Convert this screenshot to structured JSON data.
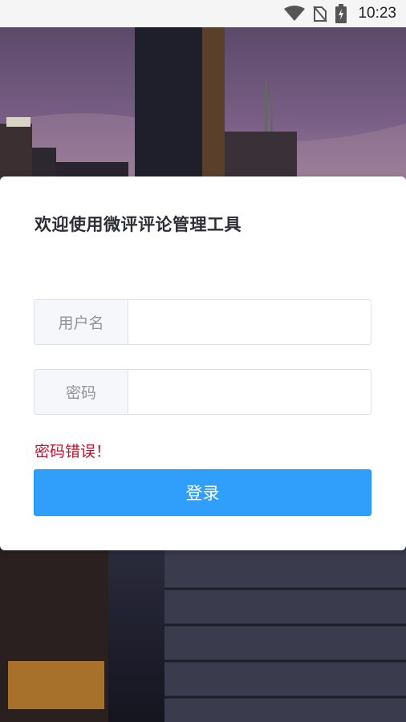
{
  "status_bar": {
    "time": "10:23",
    "icons": [
      "wifi-icon",
      "no-sim-icon",
      "battery-charging-icon"
    ]
  },
  "login": {
    "title": "欢迎使用微评评论管理工具",
    "username_label": "用户名",
    "username_value": "",
    "password_label": "密码",
    "password_value": "",
    "error_message": "密码错误！",
    "submit_label": "登录"
  },
  "colors": {
    "primary": "#2f9ffb",
    "error": "#c8102e",
    "title": "#2b2f33"
  }
}
